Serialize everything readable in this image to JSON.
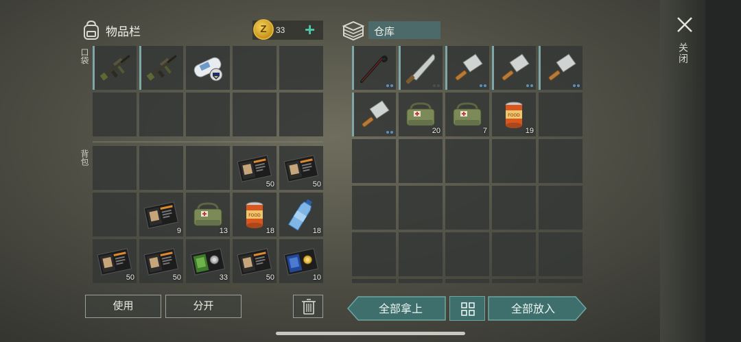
{
  "inventory": {
    "title": "物品栏",
    "coins": "33",
    "coin_symbol": "Z",
    "pocket_label": "口袋",
    "backpack_label": "背包",
    "pocket_slots": [
      {
        "icon": "rifle-icon",
        "qty": ""
      },
      {
        "icon": "rifle-icon",
        "qty": ""
      },
      {
        "icon": "map-scroll-icon",
        "qty": ""
      },
      {
        "icon": "",
        "qty": ""
      },
      {
        "icon": "",
        "qty": ""
      },
      {
        "icon": "",
        "qty": ""
      },
      {
        "icon": "",
        "qty": ""
      },
      {
        "icon": "",
        "qty": ""
      },
      {
        "icon": "",
        "qty": ""
      },
      {
        "icon": "",
        "qty": ""
      }
    ],
    "backpack_slots": [
      {
        "icon": "",
        "qty": ""
      },
      {
        "icon": "",
        "qty": ""
      },
      {
        "icon": "",
        "qty": ""
      },
      {
        "icon": "book-orange-icon",
        "qty": "50"
      },
      {
        "icon": "book-orange-icon",
        "qty": "50"
      },
      {
        "icon": "",
        "qty": ""
      },
      {
        "icon": "book-orange-icon",
        "qty": "9"
      },
      {
        "icon": "medkit-bag-icon",
        "qty": "13"
      },
      {
        "icon": "food-can-icon",
        "qty": "18"
      },
      {
        "icon": "water-bottle-icon",
        "qty": "18"
      },
      {
        "icon": "book-orange-icon",
        "qty": "50"
      },
      {
        "icon": "book-orange-icon",
        "qty": "50"
      },
      {
        "icon": "book-green-icon",
        "qty": "33"
      },
      {
        "icon": "book-orange-icon",
        "qty": "50"
      },
      {
        "icon": "book-blue-icon",
        "qty": "10"
      }
    ],
    "use_button": "使用",
    "split_button": "分开"
  },
  "warehouse": {
    "title": "仓库",
    "slots": [
      {
        "icon": "crowbar-icon",
        "qty": "",
        "dots": 2
      },
      {
        "icon": "machete-icon",
        "qty": "",
        "dots": 0
      },
      {
        "icon": "cleaver-icon",
        "qty": "",
        "dots": 2
      },
      {
        "icon": "cleaver-icon",
        "qty": "",
        "dots": 2
      },
      {
        "icon": "cleaver-icon",
        "qty": "",
        "dots": 2
      },
      {
        "icon": "cleaver-icon",
        "qty": "",
        "dots": 2
      },
      {
        "icon": "medkit-bag-icon",
        "qty": "20",
        "dots": 0
      },
      {
        "icon": "medkit-bag-icon",
        "qty": "7",
        "dots": 0
      },
      {
        "icon": "food-can-icon",
        "qty": "19",
        "dots": 0
      },
      {
        "icon": "",
        "qty": "",
        "dots": 0
      },
      {
        "icon": "",
        "qty": "",
        "dots": 0
      },
      {
        "icon": "",
        "qty": "",
        "dots": 0
      },
      {
        "icon": "",
        "qty": "",
        "dots": 0
      },
      {
        "icon": "",
        "qty": "",
        "dots": 0
      },
      {
        "icon": "",
        "qty": "",
        "dots": 0
      },
      {
        "icon": "",
        "qty": "",
        "dots": 0
      },
      {
        "icon": "",
        "qty": "",
        "dots": 0
      },
      {
        "icon": "",
        "qty": "",
        "dots": 0
      },
      {
        "icon": "",
        "qty": "",
        "dots": 0
      },
      {
        "icon": "",
        "qty": "",
        "dots": 0
      },
      {
        "icon": "",
        "qty": "",
        "dots": 0
      },
      {
        "icon": "",
        "qty": "",
        "dots": 0
      },
      {
        "icon": "",
        "qty": "",
        "dots": 0
      },
      {
        "icon": "",
        "qty": "",
        "dots": 0
      },
      {
        "icon": "",
        "qty": "",
        "dots": 0
      },
      {
        "icon": "",
        "qty": "",
        "dots": 0
      },
      {
        "icon": "",
        "qty": "",
        "dots": 0
      },
      {
        "icon": "",
        "qty": "",
        "dots": 0
      },
      {
        "icon": "",
        "qty": "",
        "dots": 0
      },
      {
        "icon": "",
        "qty": "",
        "dots": 0
      }
    ],
    "take_all_button": "全部拿上",
    "put_all_button": "全部放入"
  },
  "close_label": "关闭",
  "colors": {
    "accent": "#4fc6ab",
    "teal_button": "#3e6f6c",
    "slot_bg": "#343836"
  }
}
